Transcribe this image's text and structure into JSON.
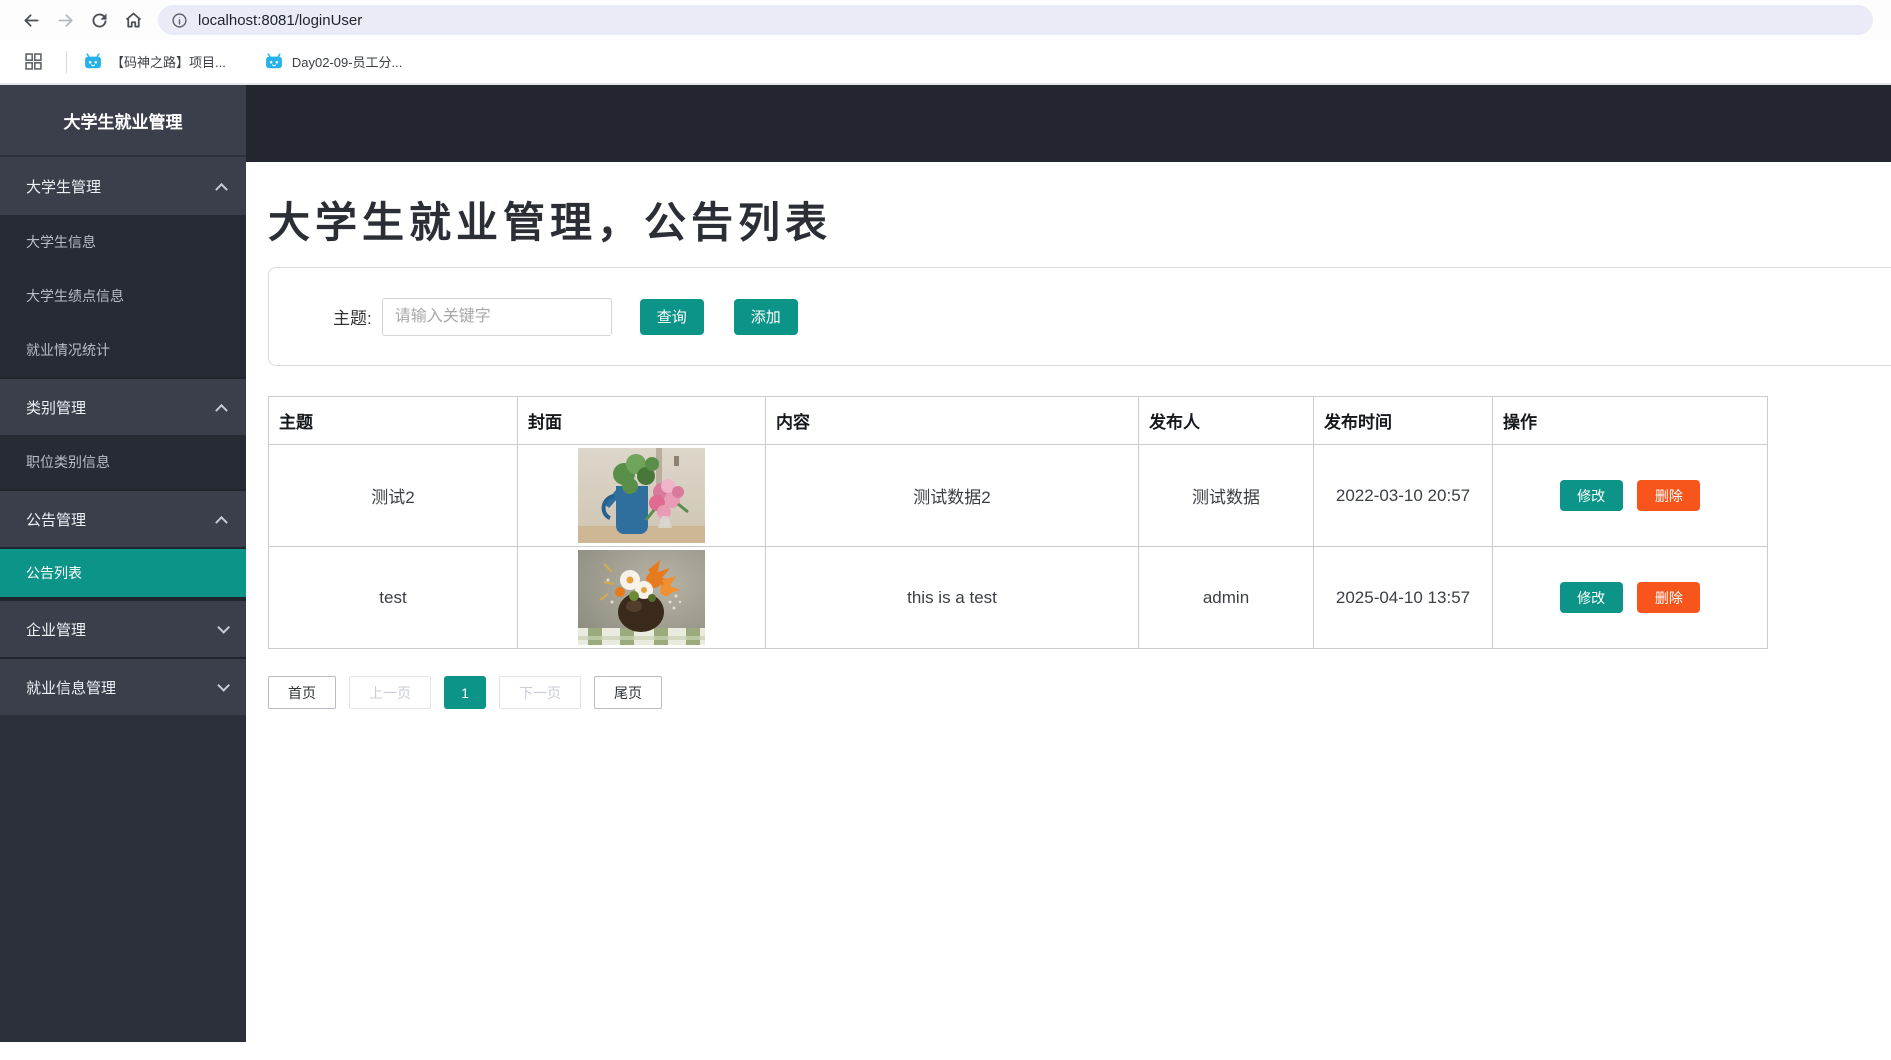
{
  "browser": {
    "url": "localhost:8081/loginUser",
    "bookmarks": [
      {
        "label": "【码神之路】项目..."
      },
      {
        "label": "Day02-09-员工分..."
      }
    ]
  },
  "sidebar": {
    "title": "大学生就业管理",
    "items": [
      {
        "label": "大学生管理",
        "type": "section",
        "chevron": "up"
      },
      {
        "label": "大学生信息",
        "type": "item"
      },
      {
        "label": "大学生绩点信息",
        "type": "item"
      },
      {
        "label": "就业情况统计",
        "type": "item"
      },
      {
        "label": "类别管理",
        "type": "section",
        "chevron": "up"
      },
      {
        "label": "职位类别信息",
        "type": "item"
      },
      {
        "label": "公告管理",
        "type": "section",
        "chevron": "up"
      },
      {
        "label": "公告列表",
        "type": "item",
        "active": true
      },
      {
        "label": "企业管理",
        "type": "section",
        "chevron": "down"
      },
      {
        "label": "就业信息管理",
        "type": "section",
        "chevron": "down"
      }
    ]
  },
  "main": {
    "title": "大学生就业管理，公告列表",
    "search": {
      "label": "主题:",
      "placeholder": "请输入关键字",
      "query": "查询",
      "add": "添加"
    },
    "table": {
      "headers": [
        "主题",
        "封面",
        "内容",
        "发布人",
        "发布时间",
        "操作"
      ],
      "rows": [
        {
          "subject": "测试2",
          "cover": "pink-roses-with-blue-watering-can",
          "content": "测试数据2",
          "publisher": "测试数据",
          "published_at": "2022-03-10 20:57"
        },
        {
          "subject": "test",
          "cover": "orange-and-white-flowers-in-dark-vase",
          "content": "this is a test",
          "publisher": "admin",
          "published_at": "2025-04-10 13:57"
        }
      ],
      "actions": {
        "edit": "修改",
        "delete": "删除"
      }
    },
    "pagination": {
      "first": "首页",
      "prev": "上一页",
      "current": "1",
      "next": "下一页",
      "last": "尾页"
    }
  },
  "colors": {
    "accent_teal": "#0c9488",
    "danger_orange": "#f8551c",
    "topbar_dark": "#23262e",
    "sidebar_section": "#3a3f4b",
    "sidebar_item_bg": "#262b34"
  }
}
